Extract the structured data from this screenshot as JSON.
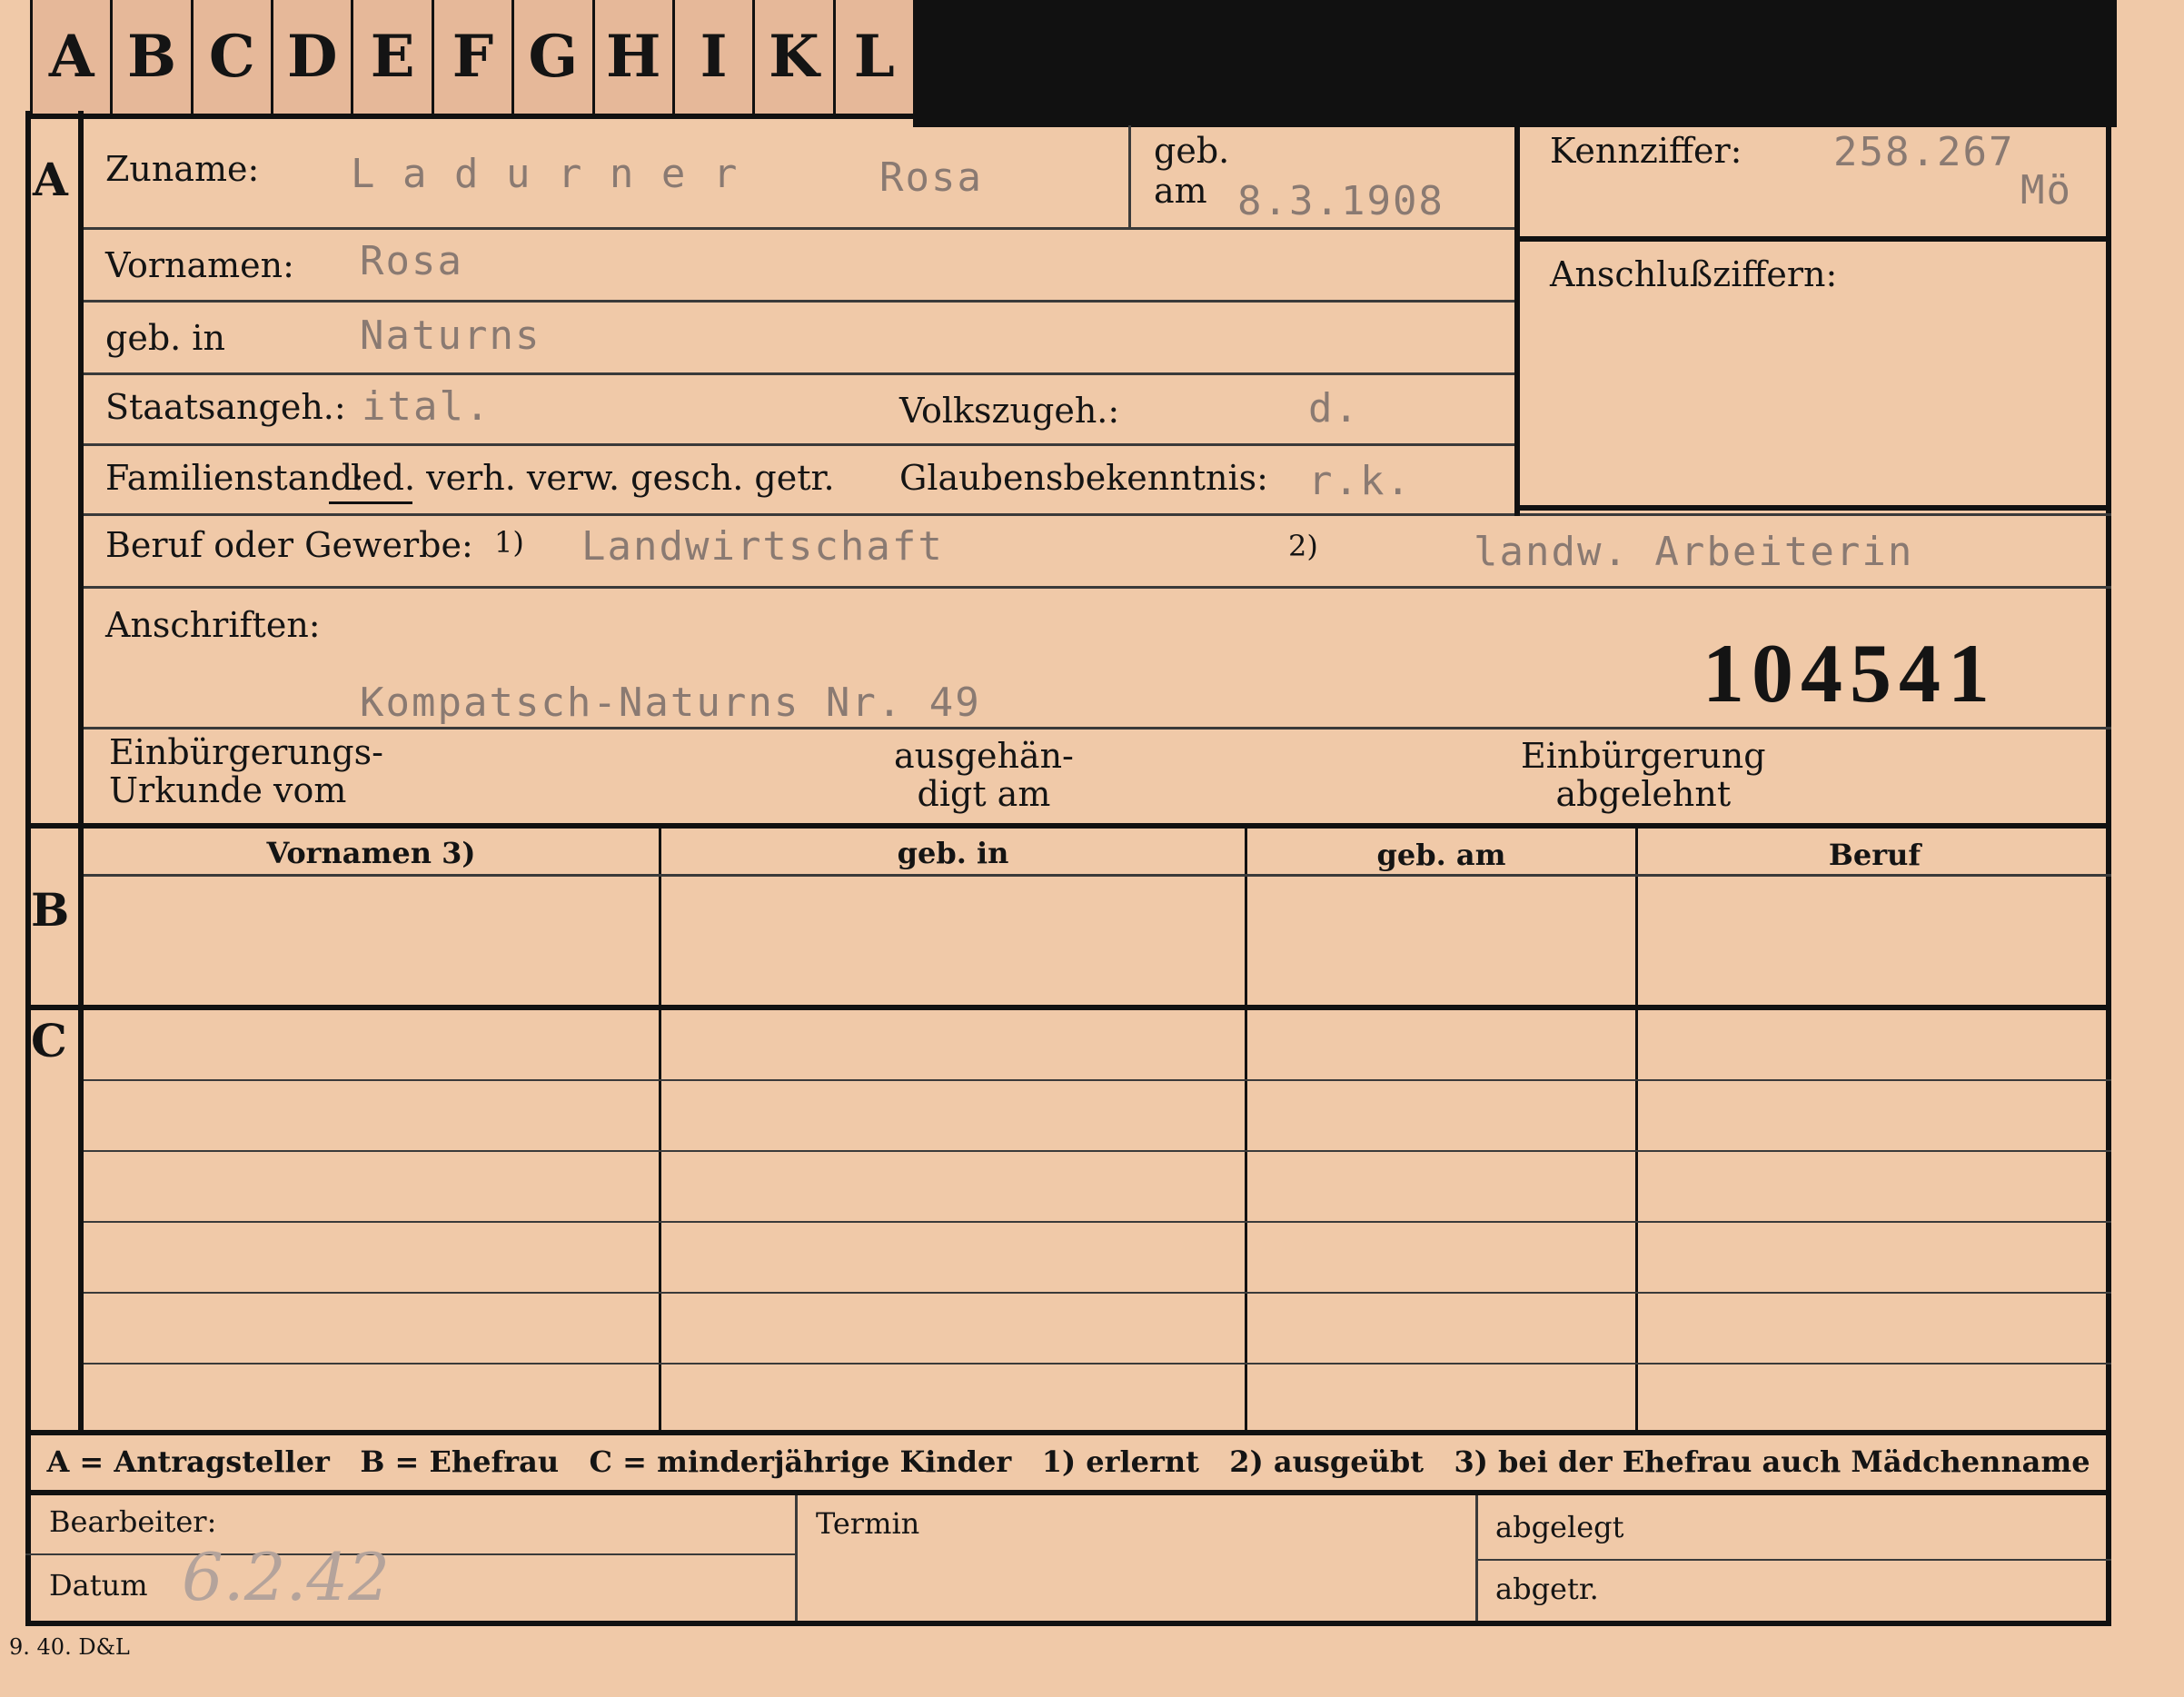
{
  "tabs": [
    "A",
    "B",
    "C",
    "D",
    "E",
    "F",
    "G",
    "H",
    "I",
    "K",
    "L"
  ],
  "sections": {
    "a": "A",
    "b": "B",
    "c": "C"
  },
  "labels": {
    "zuname": "Zuname:",
    "geb": "geb.",
    "am": "am",
    "kennziffer": "Kennziffer:",
    "anschluss": "Anschlußziffern:",
    "vornamen": "Vornamen:",
    "geb_in": "geb. in",
    "staatsangeh": "Staatsangeh.:",
    "volkszugeh": "Volkszugeh.:",
    "familienstand": "Familienstand:",
    "fam_options": "led. verh. verw. gesch. getr.",
    "glauben": "Glaubensbekenntnis:",
    "beruf": "Beruf oder Gewerbe:",
    "fn1": "1)",
    "fn2": "2)",
    "anschriften": "Anschriften:",
    "einb_urkunde": "Einbürgerungs-\nUrkunde vom",
    "ausgehaendigt": "ausgehän-\ndigt am",
    "einb_abgelehnt": "Einbürgerung\nabgelehnt",
    "legend": "A = Antragsteller   B = Ehefrau   C = minderjährige Kinder   1) erlernt   2) ausgeübt   3) bei der Ehefrau auch Mädchenname",
    "bearbeiter": "Bearbeiter:",
    "datum": "Datum",
    "termin": "Termin",
    "abgelegt": "abgelegt",
    "abgetr": "abgetr.",
    "printmark": "9. 40. D&L"
  },
  "table_headers": [
    "Vornamen 3)",
    "geb. in",
    "geb. am",
    "Beruf"
  ],
  "values": {
    "zuname": "L a d u r n e r",
    "zuname_first": "Rosa",
    "geb_am": "8.3.1908",
    "kennziffer": "258.267",
    "kennziffer_suffix": "Mö",
    "vornamen": "Rosa",
    "geb_in": "Naturns",
    "staatsangeh": "ital.",
    "volkszugeh": "d.",
    "glauben": "r.k.",
    "beruf1": "Landwirtschaft",
    "beruf2": "landw. Arbeiterin",
    "anschrift": "Kompatsch-Naturns Nr. 49",
    "number": "104541",
    "datum_hand": "6.2.42"
  }
}
